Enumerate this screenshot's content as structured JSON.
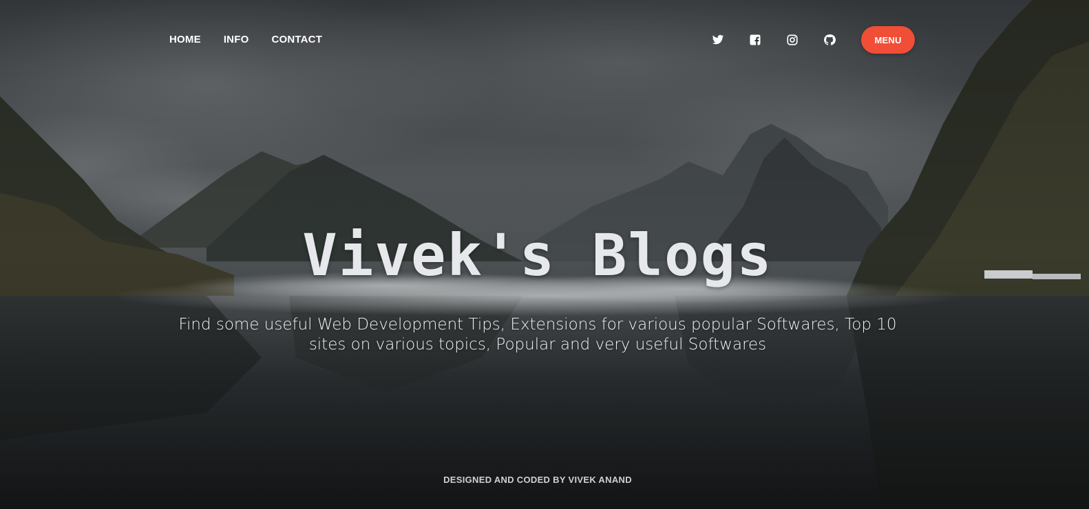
{
  "nav": {
    "links": [
      "HOME",
      "INFO",
      "CONTACT"
    ],
    "social": [
      "twitter-icon",
      "facebook-icon",
      "instagram-icon",
      "github-icon"
    ],
    "menu_label": "MENU",
    "menu_color": "#f04e37"
  },
  "hero": {
    "title": "Vivek's Blogs",
    "subtitle": "Find some useful Web Development Tips, Extensions for various popular Softwares, Top 10 sites on various topics, Popular and very useful Softwares"
  },
  "footer": {
    "credit": "DESIGNED AND CODED BY VIVEK ANAND"
  }
}
